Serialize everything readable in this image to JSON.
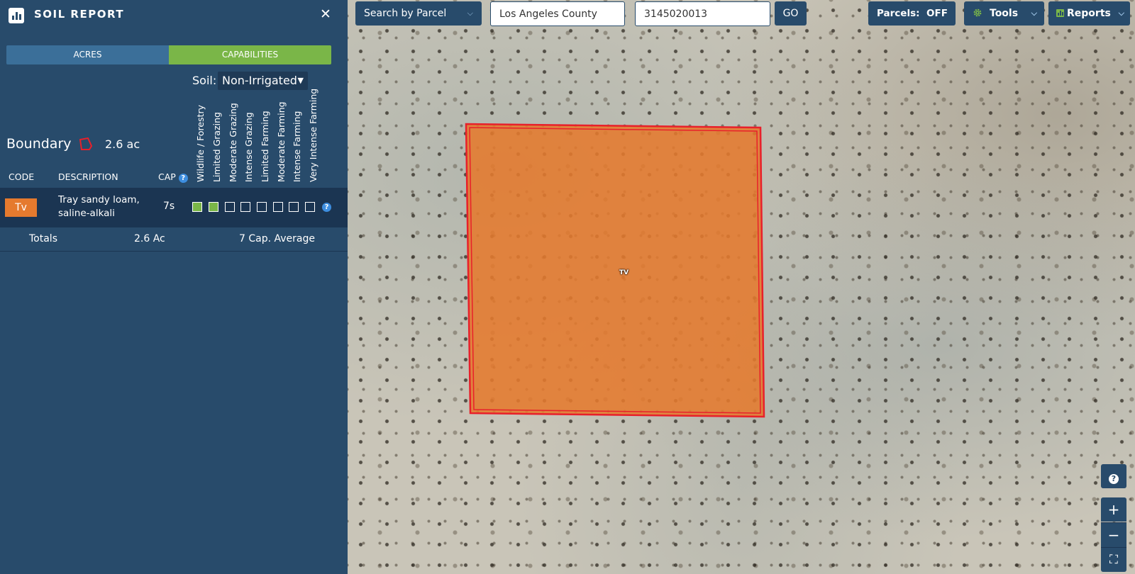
{
  "sidebar": {
    "title": "SOIL REPORT",
    "close_label": "✕",
    "tabs": [
      {
        "label": "ACRES"
      },
      {
        "label": "CAPABILITIES"
      }
    ],
    "soil_label": "Soil:",
    "soil_selected": "Non-Irrigated",
    "boundary_label": "Boundary",
    "boundary_area": "2.6 ac",
    "capability_columns": [
      "Wildlife / Forestry",
      "Limited Grazing",
      "Moderate Grazing",
      "Intense Grazing",
      "Limited Farming",
      "Moderate Farming",
      "Intense Farming",
      "Very Intense Farming"
    ],
    "headers": {
      "code": "CODE",
      "description": "DESCRIPTION",
      "cap": "CAP"
    },
    "rows": [
      {
        "code": "Tv",
        "description_line1": "Tray sandy loam,",
        "description_line2": "saline-alkali",
        "cap": "7s",
        "capabilities_checked": [
          true,
          true,
          false,
          false,
          false,
          false,
          false,
          false
        ]
      }
    ],
    "totals": {
      "label": "Totals",
      "acres": "2.6 Ac",
      "cap_average": "7 Cap. Average"
    },
    "help_glyph": "?"
  },
  "toolbar": {
    "search_by": "Search by Parcel",
    "county_value": "Los Angeles County",
    "parcel_value": "3145020013",
    "go_label": "GO",
    "parcels_label": "Parcels:",
    "parcels_state": "OFF",
    "tools_label": "Tools",
    "reports_label": "Reports"
  },
  "map": {
    "parcel_label": "TV",
    "zoom_in": "+",
    "zoom_out": "−",
    "fullscreen": "⛶",
    "help": "?"
  },
  "colors": {
    "panel": "#284b6b",
    "accent_green": "#7ab648",
    "soil_orange": "#e57a2e",
    "boundary_red": "#e8202a"
  }
}
